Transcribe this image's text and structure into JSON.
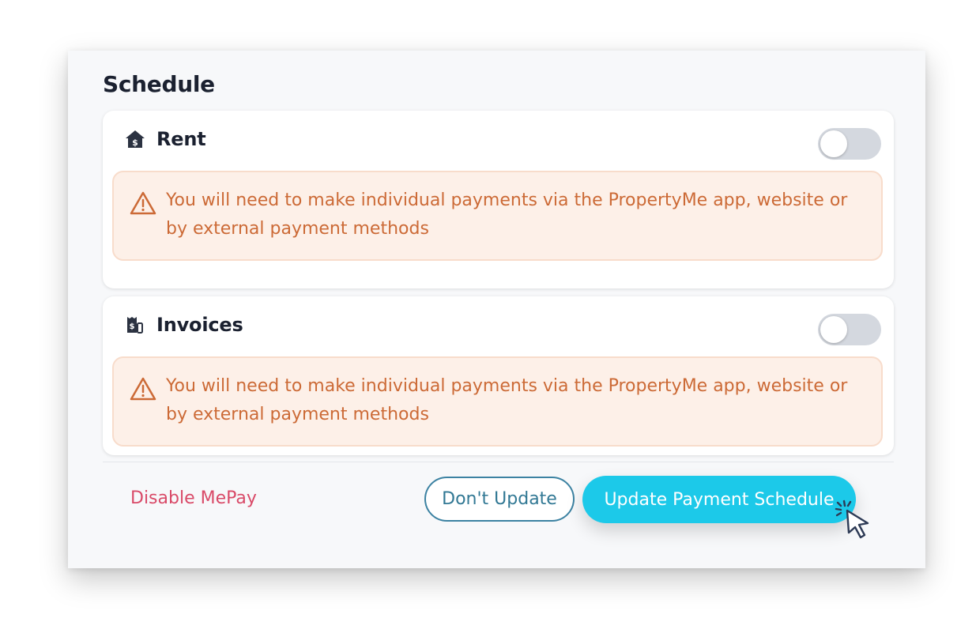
{
  "schedule": {
    "title": "Schedule",
    "rent": {
      "label": "Rent",
      "icon": "house-dollar-icon",
      "enabled": false,
      "warning": "You will need to make individual payments via the PropertyMe app, website or by external payment methods"
    },
    "invoices": {
      "label": "Invoices",
      "icon": "invoice-dollar-icon",
      "enabled": false,
      "warning": "You will need to make individual payments via the PropertyMe app, website or by external payment methods"
    }
  },
  "footer": {
    "disable_label": "Disable MePay",
    "dont_update_label": "Don't Update",
    "update_label": "Update Payment Schedule"
  },
  "colors": {
    "accent": "#1cc9e9",
    "warning_text": "#cc6a36",
    "warning_bg": "#fdf0e8",
    "danger_link": "#d94a68"
  }
}
